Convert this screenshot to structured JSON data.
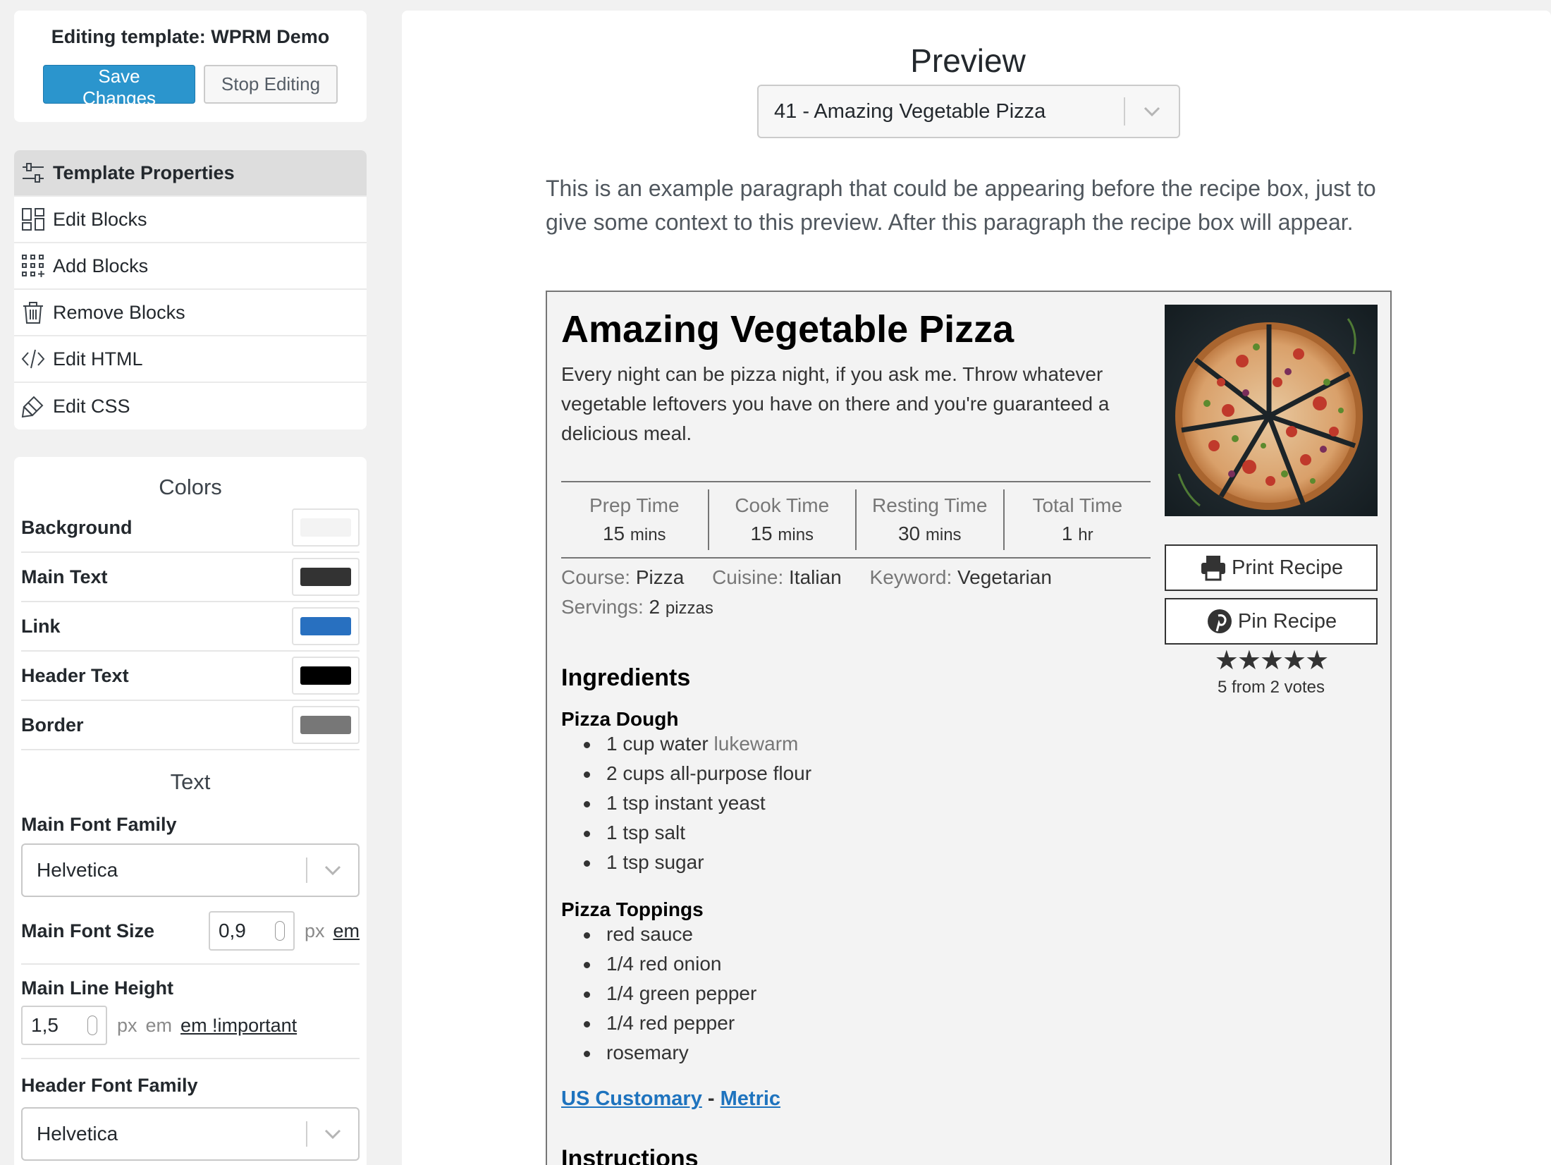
{
  "editor": {
    "title": "Editing template: WPRM Demo",
    "save_label": "Save Changes",
    "stop_label": "Stop Editing"
  },
  "menu": {
    "items": [
      {
        "label": "Template Properties",
        "icon": "sliders-icon"
      },
      {
        "label": "Edit Blocks",
        "icon": "layout-blocks-icon"
      },
      {
        "label": "Add Blocks",
        "icon": "add-grid-icon"
      },
      {
        "label": "Remove Blocks",
        "icon": "trash-icon"
      },
      {
        "label": "Edit HTML",
        "icon": "code-icon"
      },
      {
        "label": "Edit CSS",
        "icon": "paint-icon"
      }
    ]
  },
  "colors": {
    "title": "Colors",
    "items": [
      {
        "label": "Background",
        "color": "#f3f3f3"
      },
      {
        "label": "Main Text",
        "color": "#333333"
      },
      {
        "label": "Link",
        "color": "#2870c0"
      },
      {
        "label": "Header Text",
        "color": "#000000"
      },
      {
        "label": "Border",
        "color": "#777777"
      }
    ]
  },
  "text": {
    "title": "Text",
    "main_font_family_label": "Main Font Family",
    "main_font_family_value": "Helvetica",
    "main_font_size_label": "Main Font Size",
    "main_font_size_value": "0,9",
    "main_line_height_label": "Main Line Height",
    "main_line_height_value": "1,5",
    "header_font_family_label": "Header Font Family",
    "header_font_family_value": "Helvetica",
    "unit_px": "px",
    "unit_em": "em",
    "unit_em_important": "em !important"
  },
  "preview": {
    "title": "Preview",
    "selected_recipe": "41 - Amazing Vegetable Pizza",
    "intro": "This is an example paragraph that could be appearing before the recipe box, just to give some context to this preview. After this paragraph the recipe box will appear."
  },
  "recipe": {
    "name": "Amazing Vegetable Pizza",
    "summary": "Every night can be pizza night, if you ask me. Throw whatever vegetable leftovers you have on there and you're guaranteed a delicious meal.",
    "times": [
      {
        "label": "Prep Time",
        "value": "15",
        "unit": "mins"
      },
      {
        "label": "Cook Time",
        "value": "15",
        "unit": "mins"
      },
      {
        "label": "Resting Time",
        "value": "30",
        "unit": "mins"
      },
      {
        "label": "Total Time",
        "value": "1",
        "unit": "hr"
      }
    ],
    "print_label": "Print Recipe",
    "pin_label": "Pin Recipe",
    "rating_value": 5,
    "rating_text": "5 from 2 votes",
    "tags": {
      "course_label": "Course:",
      "course": "Pizza",
      "cuisine_label": "Cuisine:",
      "cuisine": "Italian",
      "keyword_label": "Keyword:",
      "keyword": "Vegetarian",
      "servings_label": "Servings:",
      "servings": "2",
      "servings_unit": "pizzas"
    },
    "ingredients_title": "Ingredients",
    "groups": [
      {
        "name": "Pizza Dough",
        "items": [
          {
            "text": "1 cup water",
            "notes": "lukewarm"
          },
          {
            "text": "2 cups all-purpose flour",
            "notes": ""
          },
          {
            "text": "1 tsp instant yeast",
            "notes": ""
          },
          {
            "text": "1 tsp salt",
            "notes": ""
          },
          {
            "text": "1 tsp sugar",
            "notes": ""
          }
        ]
      },
      {
        "name": "Pizza Toppings",
        "items": [
          {
            "text": "red sauce",
            "notes": ""
          },
          {
            "text": "1/4 red onion",
            "notes": ""
          },
          {
            "text": "1/4 green pepper",
            "notes": ""
          },
          {
            "text": "1/4 red pepper",
            "notes": ""
          },
          {
            "text": "rosemary",
            "notes": ""
          }
        ]
      }
    ],
    "unit_us": "US Customary",
    "unit_sep": "-",
    "unit_metric": "Metric",
    "instructions_title": "Instructions"
  }
}
